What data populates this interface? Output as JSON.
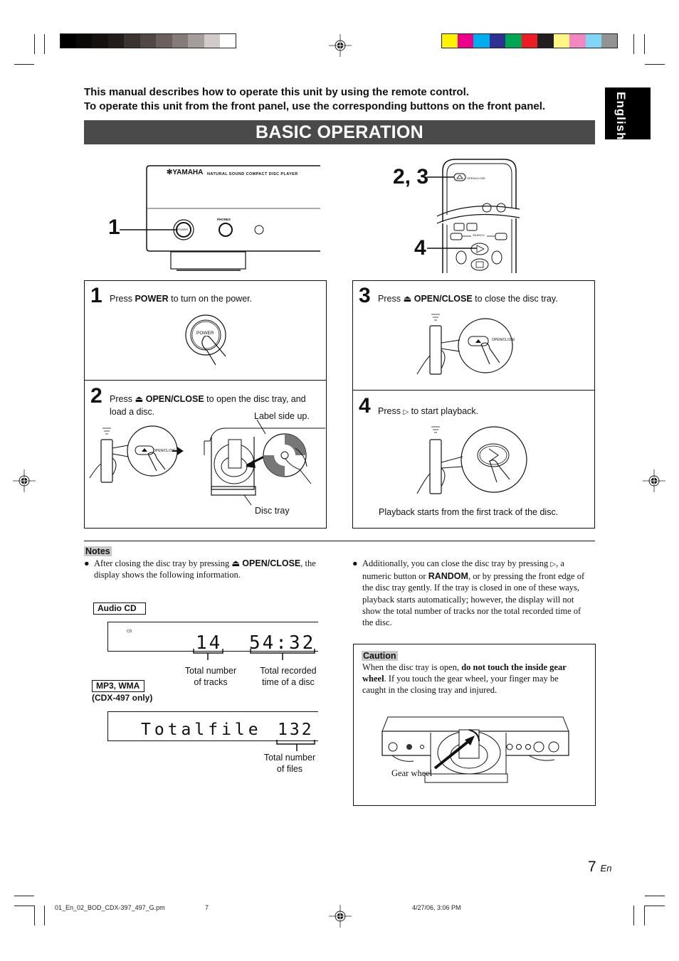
{
  "color_bars": {
    "gray": [
      "#000000",
      "#0b0908",
      "#15110f",
      "#221d1b",
      "#3b3330",
      "#514845",
      "#6b605d",
      "#857b78",
      "#a59d9b",
      "#d2cbca",
      "#ffffff"
    ],
    "process": [
      "#fff200",
      "#ec008c",
      "#00aeef",
      "#2e3192",
      "#00a651",
      "#ed1c24",
      "#231f20",
      "#fff685",
      "#f287c1",
      "#7fd6f7",
      "#939393"
    ]
  },
  "intro": {
    "line1": "This manual describes how to operate this unit by using the remote control.",
    "line2": "To operate this unit from the front panel, use the corresponding buttons on the front panel."
  },
  "title": "BASIC OPERATION",
  "language_tab": "English",
  "front_panel": {
    "callout": "1",
    "brand": "YAMAHA",
    "model_text": "NATURAL SOUND COMPACT DISC PLAYER",
    "power_label": "POWER",
    "phones_label": "PHONES"
  },
  "remote": {
    "callout_open": "2, 3",
    "callout_play": "4",
    "open_close_label": "OPEN/CLOSE",
    "search_label": "SEARCH",
    "num3": "3",
    "num4": "4"
  },
  "steps": [
    {
      "num": "1",
      "pre": "Press ",
      "bold": "POWER",
      "post": " to turn on the power.",
      "button_label": "POWER"
    },
    {
      "num": "2",
      "pre": "Press ",
      "icon": "eject",
      "bold": "OPEN/CLOSE",
      "post": " to open the disc tray, and",
      "line2": "load a disc.",
      "button_label": "OPEN/CLOSE",
      "label_side": "Label side up.",
      "disc_tray": "Disc tray"
    },
    {
      "num": "3",
      "pre": "Press ",
      "icon": "eject",
      "bold": "OPEN/CLOSE",
      "post": " to close the disc tray.",
      "button_label": "OPEN/CLOSE"
    },
    {
      "num": "4",
      "pre": "Press ",
      "icon": "play",
      "post": " to start playback.",
      "footer": "Playback starts from the first track of the disc."
    }
  ],
  "notes": {
    "heading": "Notes",
    "note1_pre": "After closing the disc tray by pressing ",
    "note1_bold": "OPEN/CLOSE",
    "note1_post": ", the",
    "note1_line2": "display shows the following information.",
    "audio_cd_label": "Audio CD",
    "cd_indicator": "CD",
    "tracks": "14",
    "time": "54:32",
    "tracks_caption_1": "Total number",
    "tracks_caption_2": "of tracks",
    "time_caption_1": "Total recorded",
    "time_caption_2": "time of a disc",
    "mp3_label": "MP3, WMA",
    "mp3_model": "(CDX-497 only)",
    "totalfile_text": "Totalfile",
    "files_count": "132",
    "files_caption_1": "Total number",
    "files_caption_2": "of files",
    "note2": {
      "l1_pre": "Additionally, you can close the disc tray by pressing ",
      "l1_post": ", a",
      "l2_pre": "numeric button or ",
      "l2_bold": "RANDOM",
      "l2_post": ", or by pressing the front edge of",
      "l3": "the disc tray gently.  If the tray is closed in one of these ways,",
      "l4": "playback starts automatically; however, the display will not",
      "l5": "show the total number of tracks nor the total recorded time of",
      "l6": "the disc."
    }
  },
  "caution": {
    "heading": "Caution",
    "l1_pre": "When the disc tray is open, ",
    "l1_bold": "do not touch the inside gear",
    "l2_bold": "wheel",
    "l2_post": ".  If you touch the gear wheel, your finger may be",
    "l3": "caught in the closing tray and injured.",
    "gear_label": "Gear wheel"
  },
  "page_number": "7",
  "page_lang": "En",
  "footer": {
    "file": "01_En_02_BOD_CDX-397_497_G.pm",
    "page": "7",
    "date": "4/27/06, 3:06 PM"
  }
}
